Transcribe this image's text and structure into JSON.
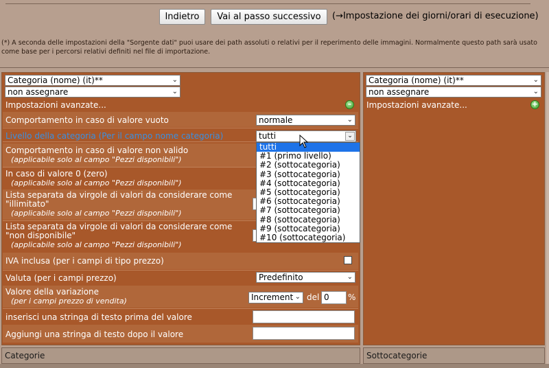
{
  "nav": {
    "back_label": "Indietro",
    "next_label": "Vai al passo successivo",
    "next_step_text": "(→Impostazione dei giorni/orari di esecuzione)"
  },
  "note": "(*) A seconda delle impostazioni della \"Sorgente dati\" puoi usare dei path assoluti o relativi per il reperimento delle immagini. Normalmente questo path sarà usato come base per i percorsi relativi definiti nel file di importazione.",
  "left_panel": {
    "field_select": "Categoria (nome) (it)**",
    "assign_select": "non assegnare",
    "advanced_label": "Impostazioni avanzate...",
    "rows": {
      "empty_value": {
        "label": "Comportamento in caso di valore vuoto",
        "value": "normale"
      },
      "category_level": {
        "label": "Livello della categoria (Per il campo nome categoria)",
        "value": "tutti"
      },
      "invalid_value": {
        "label": "Comportamento in caso di valore non valido",
        "sub": "(applicabile solo al campo \"Pezzi disponibili\")"
      },
      "zero_value": {
        "label": "In caso di valore 0 (zero)",
        "sub": "(applicabile solo al campo \"Pezzi disponibili\")"
      },
      "unlimited_list": {
        "label": "Lista separata da virgole di valori da considerare come \"illimitato\"",
        "sub": "(applicabile solo al campo \"Pezzi disponibili\")"
      },
      "unavailable_list": {
        "label": "Lista separata da virgole di valori da considerare come \"non disponibile\"",
        "sub": "(applicabile solo al campo \"Pezzi disponibili\")"
      },
      "vat_included": {
        "label": "IVA inclusa (per i campi di tipo prezzo)"
      },
      "currency": {
        "label": "Valuta (per i campi prezzo)",
        "value": "Predefinito"
      },
      "variation": {
        "label": "Valore della variazione",
        "sub": "(per i campi prezzo di vendita)",
        "mode": "Increment",
        "of_label": "del",
        "amount": "0",
        "unit": "%"
      },
      "prefix": {
        "label": "inserisci una stringa di testo prima del valore"
      },
      "suffix": {
        "label": "Aggiungi una stringa di testo dopo il valore"
      }
    },
    "level_options": [
      "tutti",
      "#1 (primo livello)",
      "#2 (sottocategoria)",
      "#3 (sottocategoria)",
      "#4 (sottocategoria)",
      "#5 (sottocategoria)",
      "#6 (sottocategoria)",
      "#7 (sottocategoria)",
      "#8 (sottocategoria)",
      "#9 (sottocategoria)",
      "#10 (sottocategoria)"
    ]
  },
  "right_panel": {
    "field_select": "Categoria (nome) (it)**",
    "assign_select": "non assegnare",
    "advanced_label": "Impostazioni avanzate..."
  },
  "footer": {
    "left_label": "Categorie",
    "right_label": "Sottocategorie"
  },
  "colors": {
    "panel_bg": "#a8582a",
    "page_bg": "#b79f8f",
    "highlight_blue": "#1e73e8",
    "link_blue": "#3b8fe0"
  }
}
